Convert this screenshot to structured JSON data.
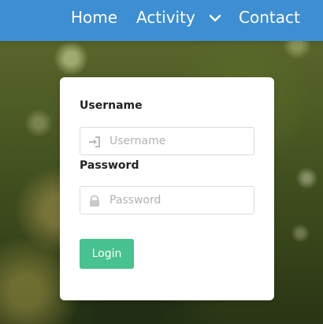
{
  "nav": {
    "home": "Home",
    "activity": "Activity",
    "activity_icon": "chevron-down-icon",
    "contact": "Contact"
  },
  "login": {
    "username_label": "Username",
    "username_placeholder": "Username",
    "username_icon": "sign-in-icon",
    "password_label": "Password",
    "password_placeholder": "Password",
    "password_icon": "lock-icon",
    "button_label": "Login"
  },
  "colors": {
    "navbar": "#3e8ed3",
    "login_button": "#48c28f"
  }
}
